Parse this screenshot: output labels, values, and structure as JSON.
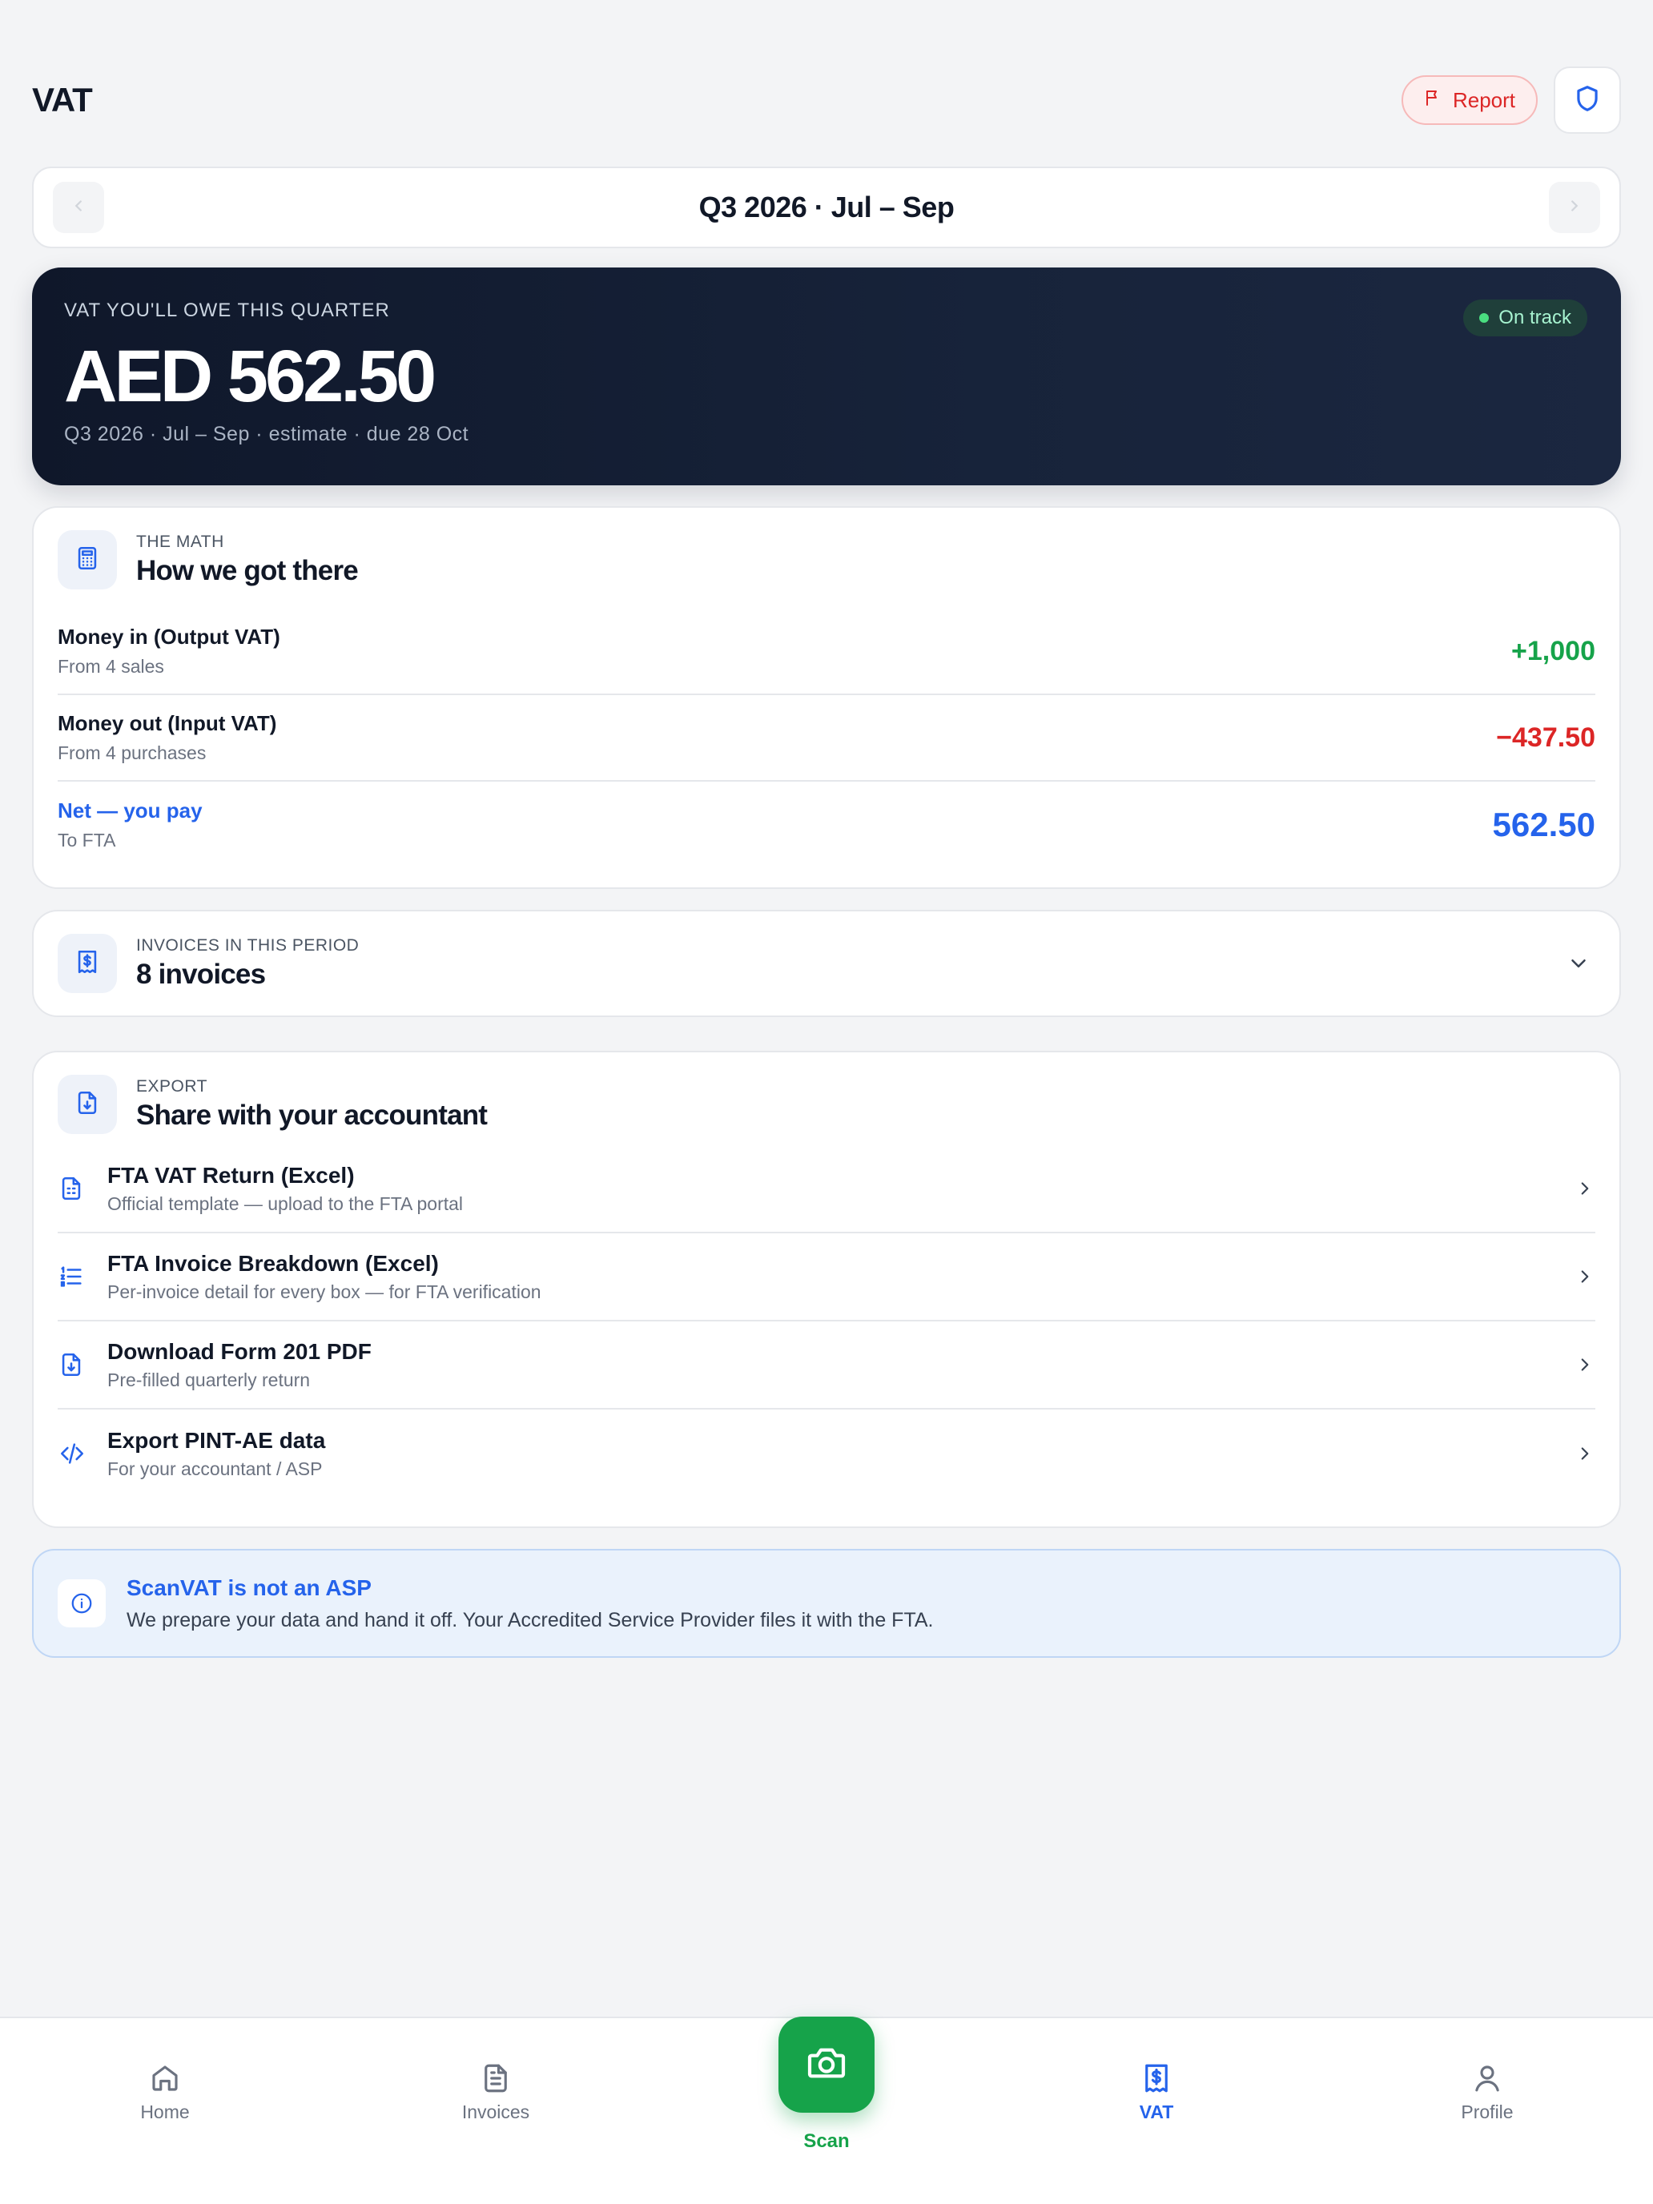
{
  "header": {
    "title": "VAT",
    "report_label": "Report"
  },
  "quarter": {
    "label": "Q3 2026 · Jul – Sep"
  },
  "hero": {
    "eyebrow": "VAT YOU'LL OWE THIS QUARTER",
    "amount": "AED 562.50",
    "subtitle": "Q3 2026 · Jul – Sep · estimate · due 28 Oct",
    "status": "On track"
  },
  "math": {
    "eyebrow": "THE MATH",
    "title": "How we got there",
    "rows": [
      {
        "label": "Money in (Output VAT)",
        "sub": "From 4 sales",
        "value": "+1,000"
      },
      {
        "label": "Money out (Input VAT)",
        "sub": "From 4 purchases",
        "value": "−437.50"
      },
      {
        "label": "Net — you pay",
        "sub": "To FTA",
        "value": "562.50"
      }
    ]
  },
  "invoices": {
    "eyebrow": "INVOICES IN THIS PERIOD",
    "title": "8 invoices"
  },
  "export": {
    "eyebrow": "EXPORT",
    "title": "Share with your accountant",
    "items": [
      {
        "title": "FTA VAT Return (Excel)",
        "sub": "Official template — upload to the FTA portal",
        "icon": "spreadsheet-doc-icon"
      },
      {
        "title": "FTA Invoice Breakdown (Excel)",
        "sub": "Per-invoice detail for every box — for FTA verification",
        "icon": "list-icon"
      },
      {
        "title": "Download Form 201 PDF",
        "sub": "Pre-filled quarterly return",
        "icon": "download-doc-icon"
      },
      {
        "title": "Export PINT-AE data",
        "sub": "For your accountant / ASP",
        "icon": "code-icon"
      }
    ]
  },
  "info": {
    "title": "ScanVAT is not an ASP",
    "body": "We prepare your data and hand it off. Your Accredited Service Provider files it with the FTA."
  },
  "nav": {
    "home": "Home",
    "invoices": "Invoices",
    "scan": "Scan",
    "vat": "VAT",
    "profile": "Profile"
  },
  "colors": {
    "accent": "#2563eb",
    "positive": "#16a34a",
    "negative": "#dc2626",
    "hero_bg": "#0f172a"
  }
}
